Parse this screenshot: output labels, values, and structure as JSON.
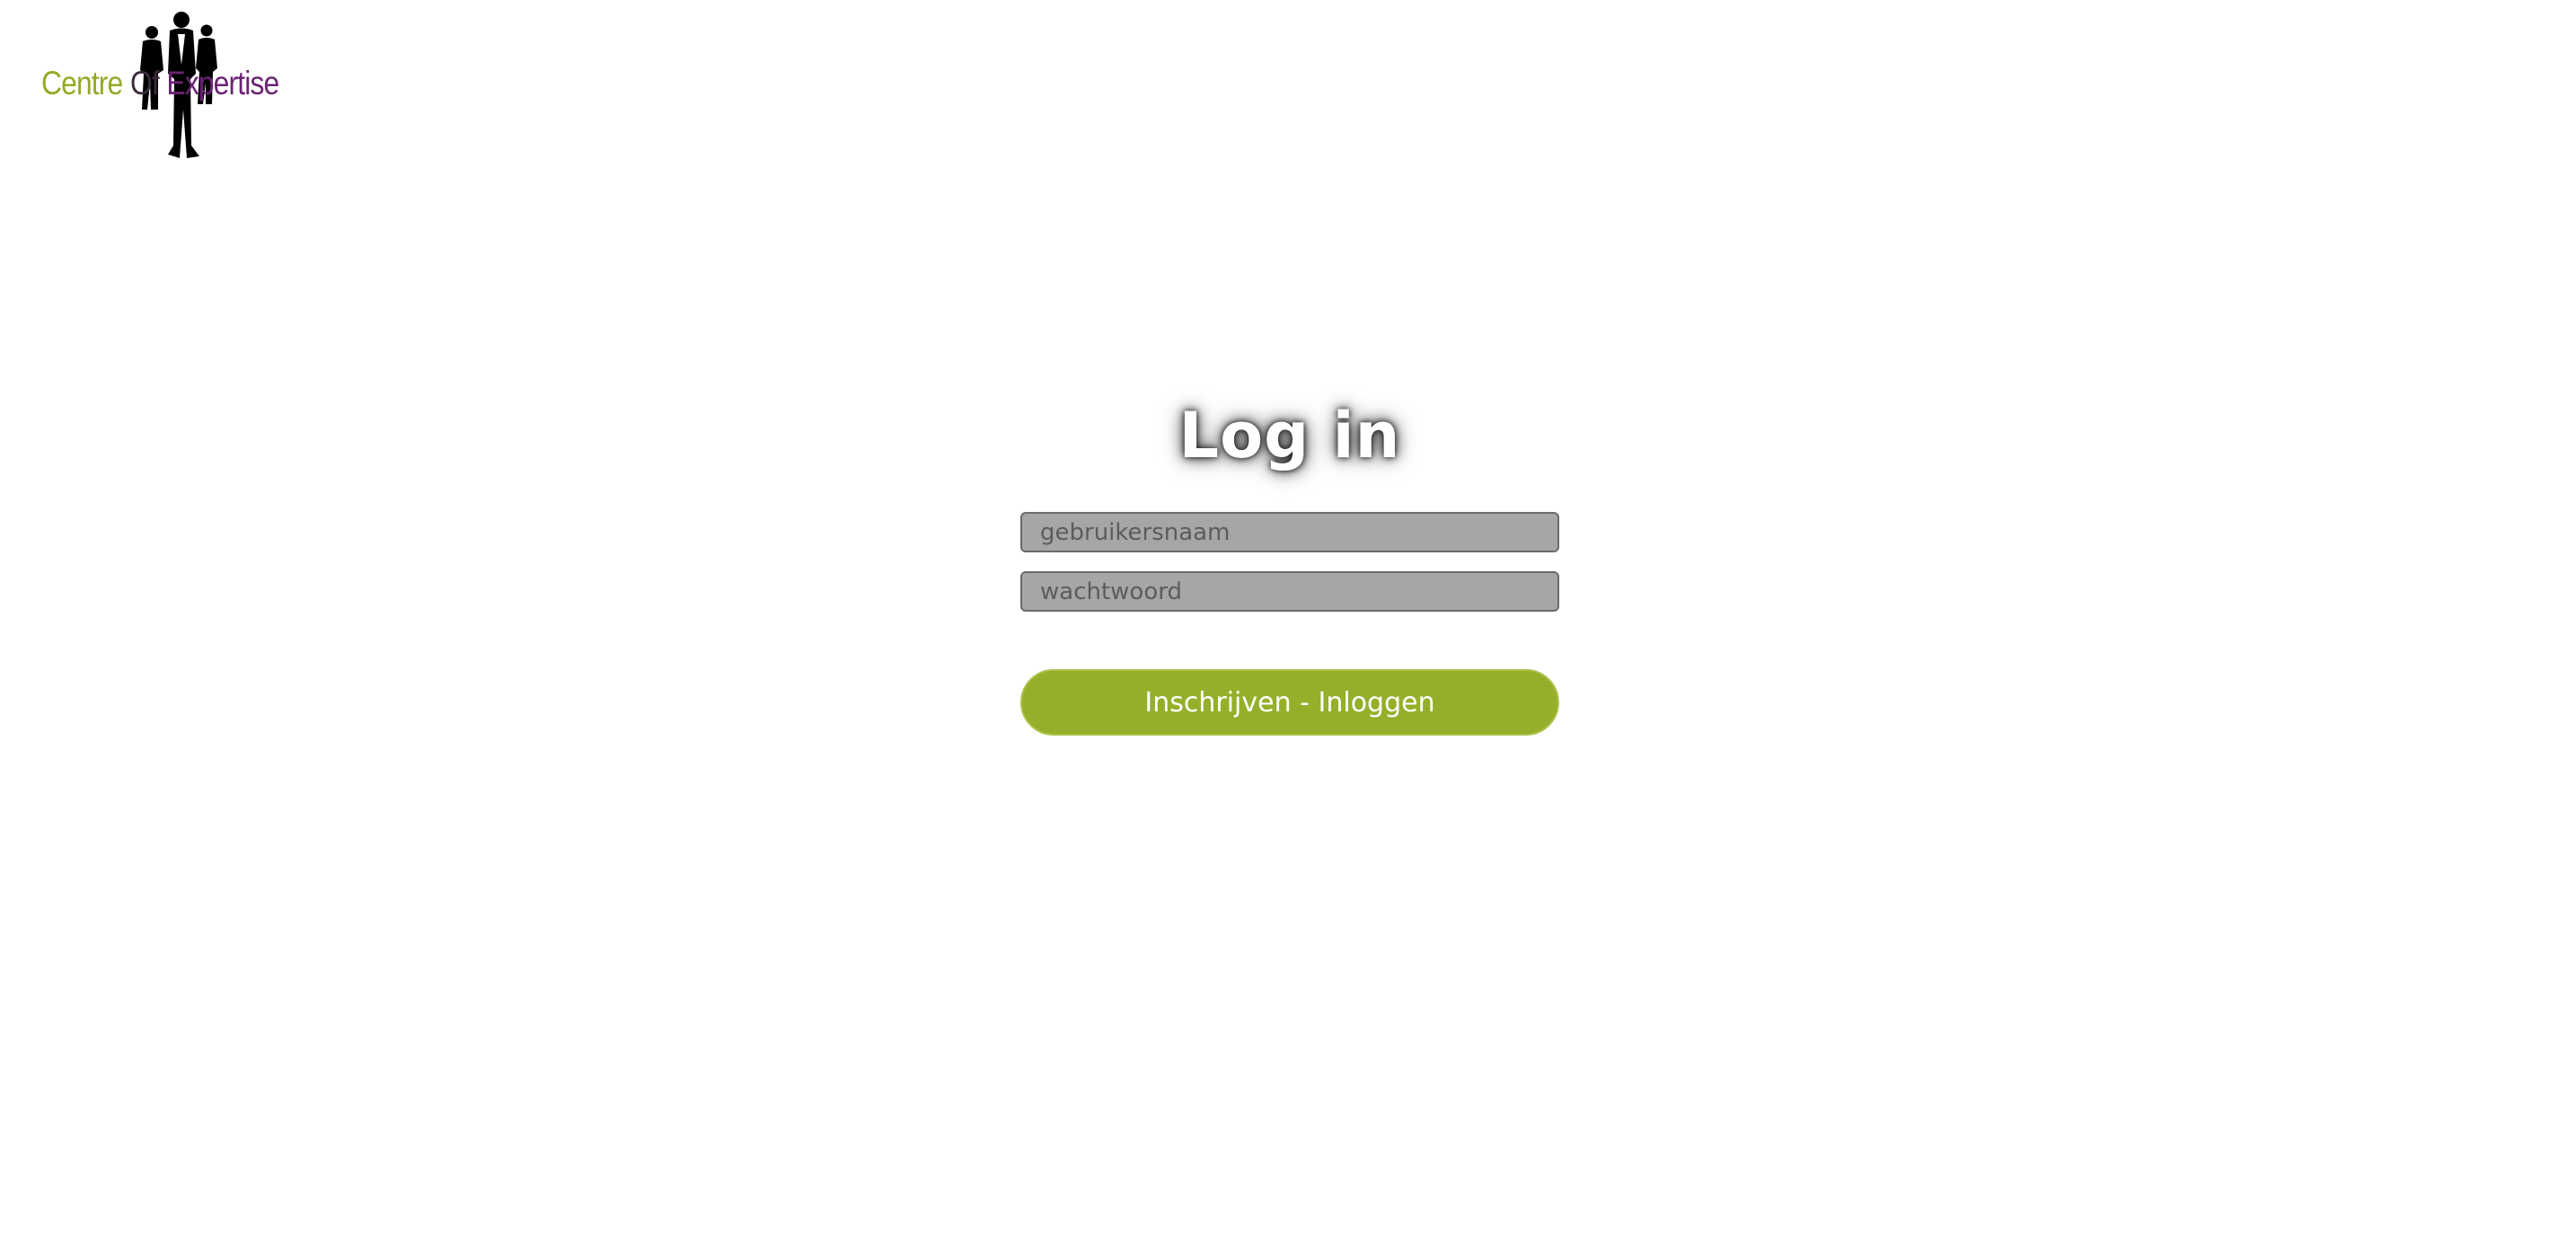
{
  "logo": {
    "word1": "Centre",
    "word2": "Of",
    "word3": "Expertise",
    "colors": {
      "green": "#93ab27",
      "dark": "#3b2a3b",
      "purple": "#6b2374"
    },
    "icon": "business-people-silhouette-icon"
  },
  "login": {
    "title": "Log in",
    "username_placeholder": "gebruikersnaam",
    "password_placeholder": "wachtwoord",
    "submit_label": "Inschrijven - Inloggen"
  },
  "colors": {
    "accent": "#96af2a",
    "input_bg": "#a6a6a6",
    "background": "#ffffff"
  }
}
